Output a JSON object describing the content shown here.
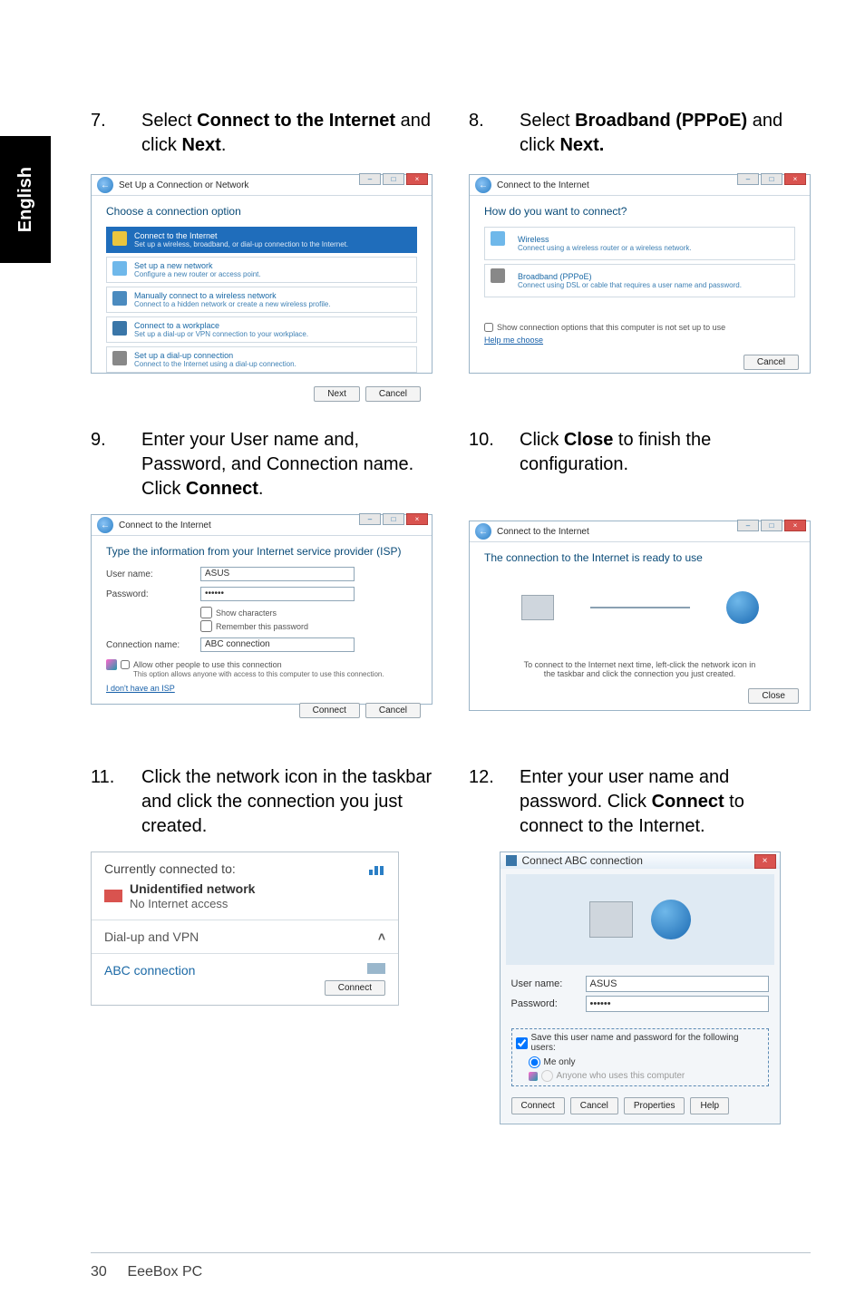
{
  "sidebar": {
    "language": "English"
  },
  "steps": {
    "s7": {
      "num": "7.",
      "pre": "Select ",
      "bold1": "Connect to the Internet",
      "mid": " and click ",
      "bold2": "Next",
      "post": "."
    },
    "s8": {
      "num": "8.",
      "pre": "Select ",
      "bold1": "Broadband (PPPoE)",
      "mid": " and click ",
      "bold2": "Next.",
      "post": ""
    },
    "s9": {
      "num": "9.",
      "text_a": "Enter your User name and, Password, and Connection name. Click ",
      "bold": "Connect",
      "text_b": "."
    },
    "s10": {
      "num": "10.",
      "text_a": "Click ",
      "bold": "Close",
      "text_b": " to finish the configuration."
    },
    "s11": {
      "num": "11.",
      "text": "Click the network icon in the taskbar and click the connection you just created."
    },
    "s12": {
      "num": "12.",
      "text_a": "Enter your user name and password. Click ",
      "bold": "Connect",
      "text_b": " to connect to the Internet."
    }
  },
  "dlg7": {
    "title": "Set Up a Connection or Network",
    "heading": "Choose a connection option",
    "options": [
      {
        "title": "Connect to the Internet",
        "sub": "Set up a wireless, broadband, or dial-up connection to the Internet."
      },
      {
        "title": "Set up a new network",
        "sub": "Configure a new router or access point."
      },
      {
        "title": "Manually connect to a wireless network",
        "sub": "Connect to a hidden network or create a new wireless profile."
      },
      {
        "title": "Connect to a workplace",
        "sub": "Set up a dial-up or VPN connection to your workplace."
      },
      {
        "title": "Set up a dial-up connection",
        "sub": "Connect to the Internet using a dial-up connection."
      }
    ],
    "next": "Next",
    "cancel": "Cancel"
  },
  "dlg8": {
    "title": "Connect to the Internet",
    "heading": "How do you want to connect?",
    "options": [
      {
        "title": "Wireless",
        "sub": "Connect using a wireless router or a wireless network."
      },
      {
        "title": "Broadband (PPPoE)",
        "sub": "Connect using DSL or cable that requires a user name and password."
      }
    ],
    "showopts_label": "Show connection options that this computer is not set up to use",
    "help": "Help me choose",
    "cancel": "Cancel"
  },
  "dlg9": {
    "title": "Connect to the Internet",
    "heading": "Type the information from your Internet service provider (ISP)",
    "username_label": "User name:",
    "username_value": "ASUS",
    "password_label": "Password:",
    "password_value": "••••••",
    "show_chars": "Show characters",
    "remember": "Remember this password",
    "conn_label": "Connection name:",
    "conn_value": "ABC connection",
    "allow_label": "Allow other people to use this connection",
    "allow_sub": "This option allows anyone with access to this computer to use this connection.",
    "no_isp": "I don't have an ISP",
    "connect": "Connect",
    "cancel": "Cancel"
  },
  "dlg10": {
    "title": "Connect to the Internet",
    "heading": "The connection to the Internet is ready to use",
    "tip1": "To connect to the Internet next time, left-click the network icon in",
    "tip2": "the taskbar and click the connection you just created.",
    "close": "Close"
  },
  "flyout": {
    "header": "Currently connected to:",
    "unidentified": "Unidentified network",
    "noaccess": "No Internet access",
    "section2": "Dial-up and VPN",
    "conn": "ABC connection",
    "connect": "Connect"
  },
  "dialer": {
    "title": "Connect ABC connection",
    "username_label": "User name:",
    "username_value": "ASUS",
    "password_label": "Password:",
    "password_value": "••••••",
    "save_label": "Save this user name and password for the following users:",
    "me_only": "Me only",
    "anyone": "Anyone who uses this computer",
    "connect": "Connect",
    "cancel": "Cancel",
    "properties": "Properties",
    "help": "Help"
  },
  "footer": {
    "page": "30",
    "product": "EeeBox PC"
  }
}
